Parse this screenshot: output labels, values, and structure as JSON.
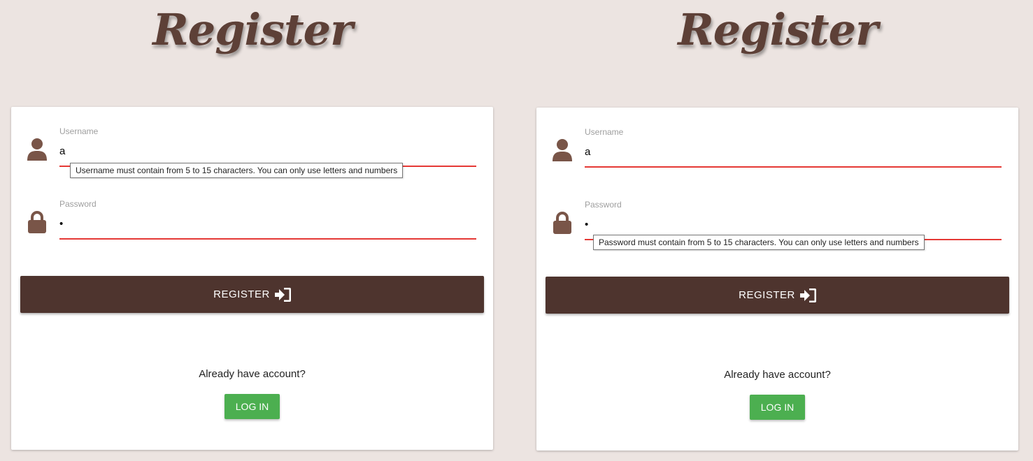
{
  "colors": {
    "background": "#ece4e1",
    "brand_brown": "#4e342e",
    "icon_brown": "#795548",
    "title_brown": "#5d4037",
    "error_red": "#e53935",
    "login_green": "#4caf50"
  },
  "panels": [
    {
      "title": "Register",
      "username": {
        "label": "Username",
        "value": "a",
        "icon": "user-icon"
      },
      "password": {
        "label": "Password",
        "value": "•",
        "icon": "lock-icon"
      },
      "tooltip": "Username must contain from 5 to 15 characters. You can only use letters and numbers",
      "register_label": "REGISTER",
      "register_icon": "sign-in-icon",
      "already_text": "Already have account?",
      "login_label": "LOG IN"
    },
    {
      "title": "Register",
      "username": {
        "label": "Username",
        "value": "a",
        "icon": "user-icon"
      },
      "password": {
        "label": "Password",
        "value": "•",
        "icon": "lock-icon"
      },
      "tooltip": "Password must contain from 5 to 15 characters. You can only use letters and numbers",
      "register_label": "REGISTER",
      "register_icon": "sign-in-icon",
      "already_text": "Already have account?",
      "login_label": "LOG IN"
    }
  ]
}
